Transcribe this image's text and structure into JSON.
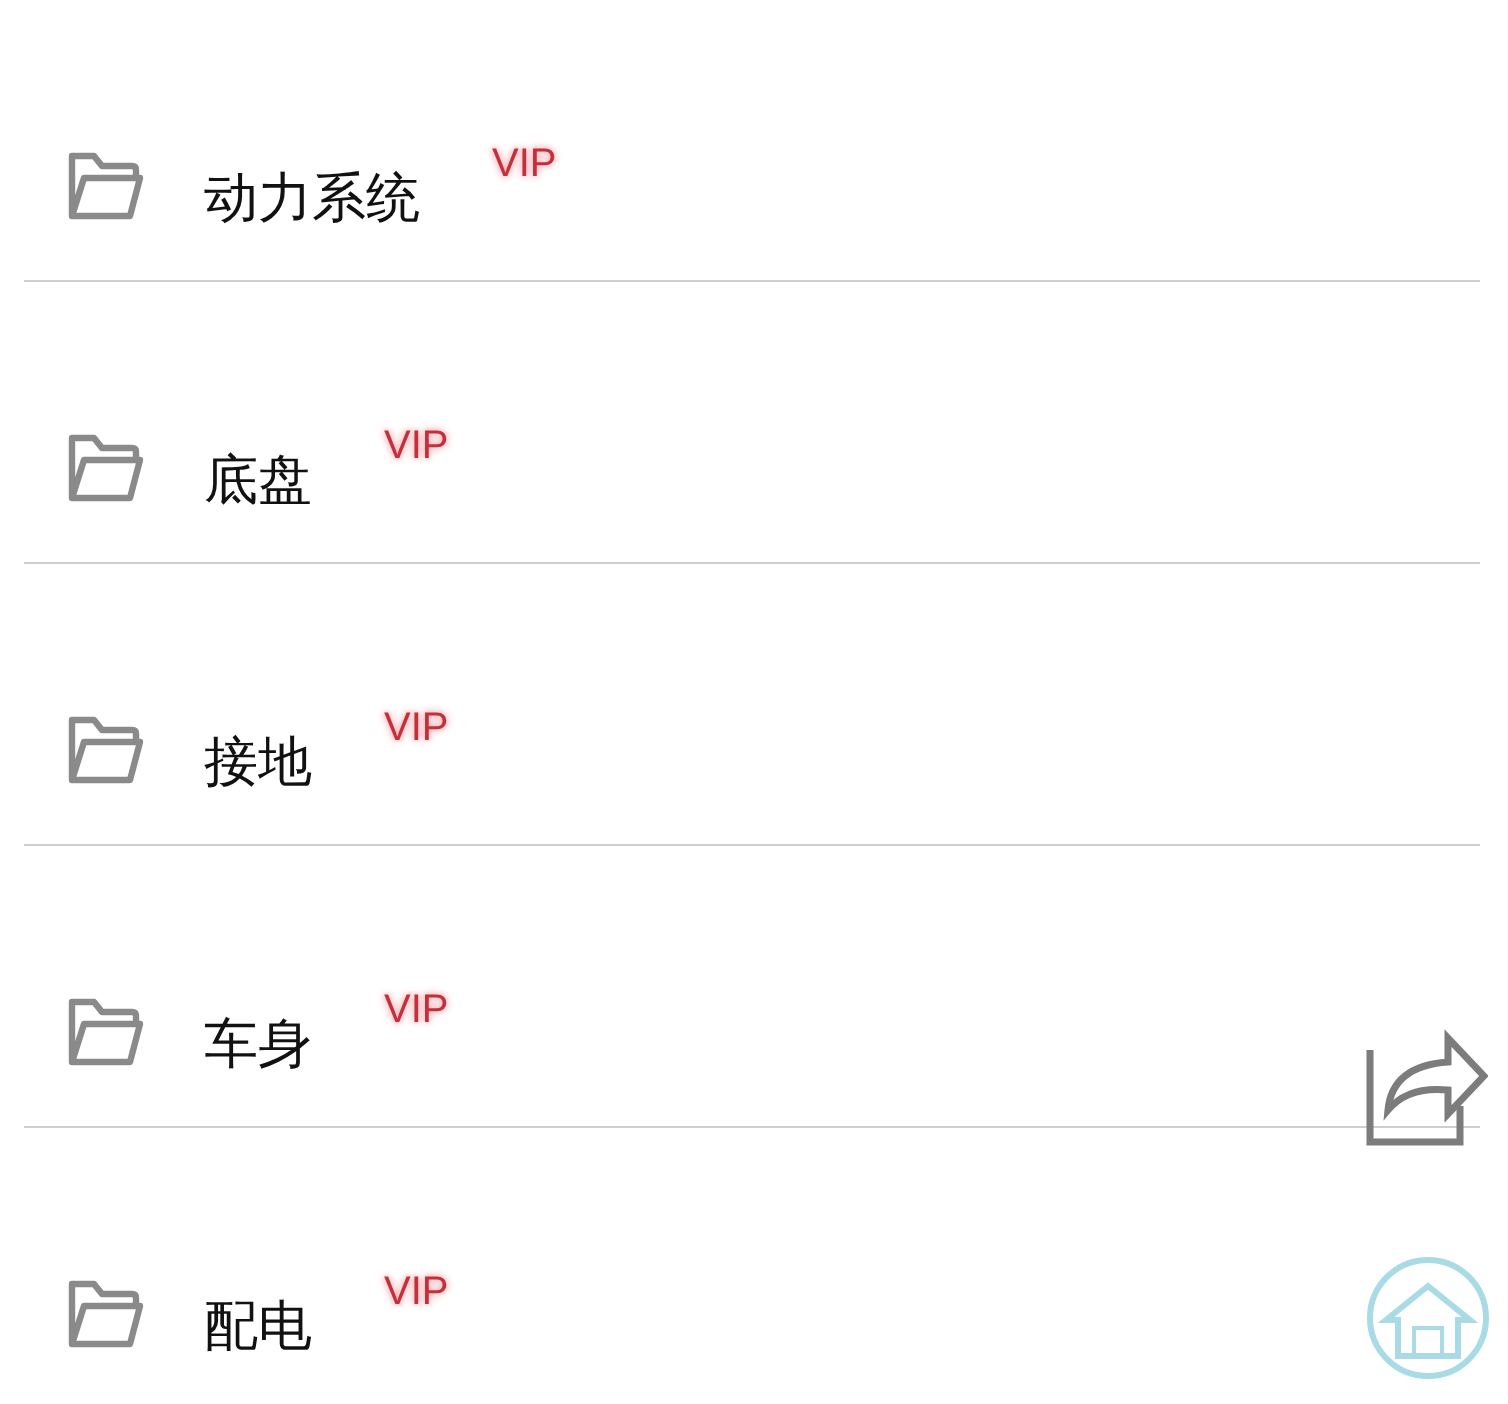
{
  "folders": [
    {
      "label": "动力系统",
      "badge": "VIP"
    },
    {
      "label": "底盘",
      "badge": "VIP"
    },
    {
      "label": "接地",
      "badge": "VIP"
    },
    {
      "label": "车身",
      "badge": "VIP"
    },
    {
      "label": "配电",
      "badge": "VIP"
    }
  ]
}
